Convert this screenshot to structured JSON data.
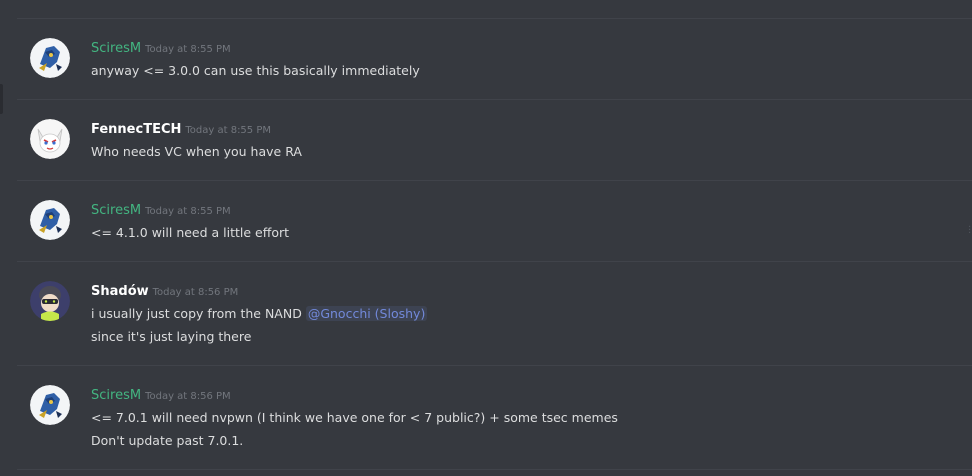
{
  "messages": [
    {
      "author": "SciresM",
      "author_color": "#43b581",
      "timestamp": "Today at 8:55 PM",
      "lines": [
        "anyway <= 3.0.0 can use this basically immediately"
      ]
    },
    {
      "author": "FennecTECH",
      "author_color": "#ffffff",
      "timestamp": "Today at 8:55 PM",
      "lines": [
        "Who needs VC when you have RA"
      ]
    },
    {
      "author": "SciresM",
      "author_color": "#43b581",
      "timestamp": "Today at 8:55 PM",
      "lines": [
        "<= 4.1.0 will need a little effort"
      ]
    },
    {
      "author": "Shadów",
      "author_color": "#ffffff",
      "timestamp": "Today at 8:56 PM",
      "line1_text": "i usually just copy from the NAND",
      "mention": "@Gnocchi (Sloshy)",
      "line2_text": "since it's just laying there"
    },
    {
      "author": "SciresM",
      "author_color": "#43b581",
      "timestamp": "Today at 8:56 PM",
      "lines": [
        "<= 7.0.1 will need nvpwn (I think we have one for < 7 public?) + some tsec memes",
        "Don't update past 7.0.1."
      ]
    }
  ],
  "colors": {
    "background": "#36393f",
    "divider": "#40434a",
    "mention": "#7289da",
    "timestamp": "#72767d"
  }
}
